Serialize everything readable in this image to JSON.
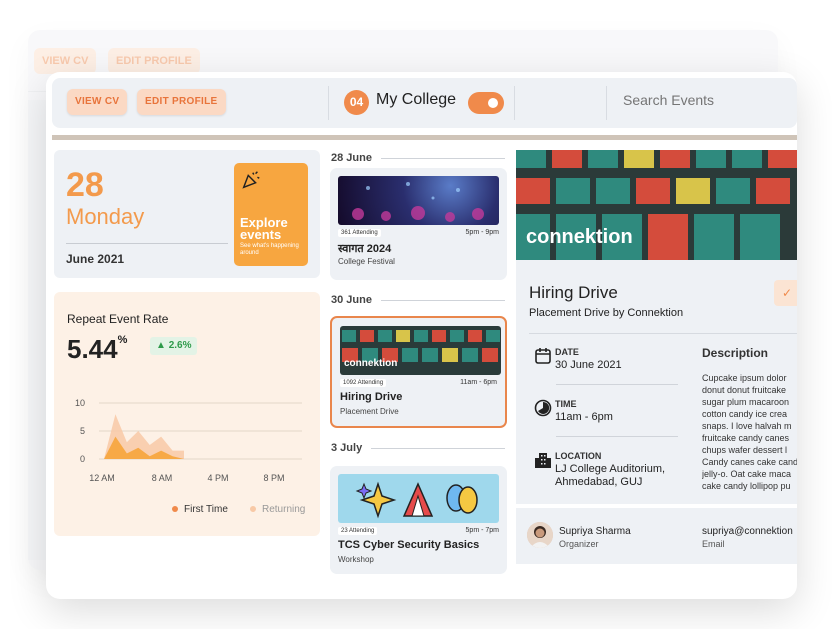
{
  "topbar": {
    "view_cv": "VIEW CV",
    "edit_profile": "EDIT PROFILE",
    "badge": "04",
    "college": "My College",
    "search_placeholder": "Search Events"
  },
  "date_card": {
    "day_num": "28",
    "weekday": "Monday",
    "month_year": "June 2021",
    "explore_title": "Explore events",
    "explore_sub": "See what's happening around"
  },
  "rate_card": {
    "title": "Repeat Event Rate",
    "value": "5.44",
    "unit": "%",
    "change": "2.6%",
    "legend": [
      "First Time",
      "Returning"
    ],
    "colors": {
      "first": "#f7a640",
      "returning": "#f8c9a6"
    }
  },
  "chart_data": {
    "type": "area",
    "x_ticks": [
      "12 AM",
      "8 AM",
      "4 PM",
      "8 PM"
    ],
    "y_ticks": [
      10,
      5,
      0
    ],
    "ylim": [
      0,
      10
    ],
    "series": [
      {
        "name": "First Time",
        "values": [
          0,
          4,
          1,
          2,
          0.5,
          1.5,
          0.5,
          0
        ]
      },
      {
        "name": "Returning",
        "values": [
          0,
          8,
          3,
          5,
          2.5,
          4,
          1.5,
          1.5
        ]
      }
    ]
  },
  "events": {
    "groups": [
      "28 June",
      "30 June",
      "3 July"
    ],
    "items": [
      {
        "attending": "361 Attending",
        "time": "5pm - 9pm",
        "name": "स्वागत 2024",
        "category": "College Festival"
      },
      {
        "attending": "1092 Attending",
        "time": "11am - 6pm",
        "name": "Hiring Drive",
        "category": "Placement Drive",
        "img_text": "connektion"
      },
      {
        "attending": "23 Attending",
        "time": "5pm - 7pm",
        "name": "TCS Cyber Security Basics",
        "category": "Workshop"
      }
    ]
  },
  "detail": {
    "brand": "connektion",
    "title": "Hiring Drive",
    "subtitle": "Placement Drive by Connektion",
    "date_label": "DATE",
    "date_value": "30 June 2021",
    "time_label": "TIME",
    "time_value": "11am - 6pm",
    "location_label": "LOCATION",
    "location_value_1": "LJ College Auditorium,",
    "location_value_2": "Ahmedabad, GUJ",
    "desc_heading": "Description",
    "description": [
      "Cupcake ipsum dolor",
      "donut donut fruitcake",
      "sugar plum macaroon",
      "cotton candy ice crea",
      "snaps. I love halvah m",
      "fruitcake candy canes",
      "chups wafer dessert l",
      "Candy canes cake cand",
      "jelly-o. Oat cake maca",
      "cake candy lollipop pu"
    ]
  },
  "organizer": {
    "name": "Supriya Sharma",
    "role": "Organizer",
    "email": "supriya@connektion",
    "email_label": "Email"
  }
}
